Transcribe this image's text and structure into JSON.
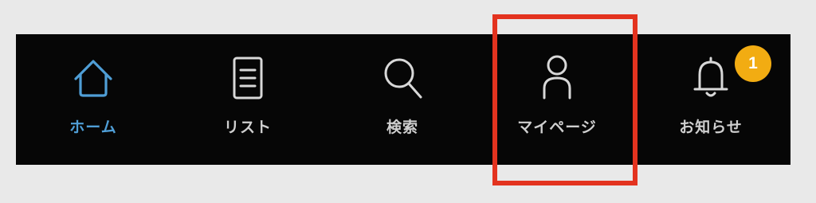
{
  "nav": {
    "items": [
      {
        "label": "ホーム",
        "icon": "home-icon",
        "active": true
      },
      {
        "label": "リスト",
        "icon": "list-icon",
        "active": false
      },
      {
        "label": "検索",
        "icon": "search-icon",
        "active": false
      },
      {
        "label": "マイページ",
        "icon": "person-icon",
        "active": false
      },
      {
        "label": "お知らせ",
        "icon": "bell-icon",
        "active": false
      }
    ],
    "notification_badge": "1"
  },
  "colors": {
    "nav_background": "#060606",
    "active": "#4f9ed6",
    "inactive": "#cfcfcf",
    "badge": "#f2ac12",
    "highlight": "#e3331f",
    "page_background": "#e9e9e9"
  }
}
